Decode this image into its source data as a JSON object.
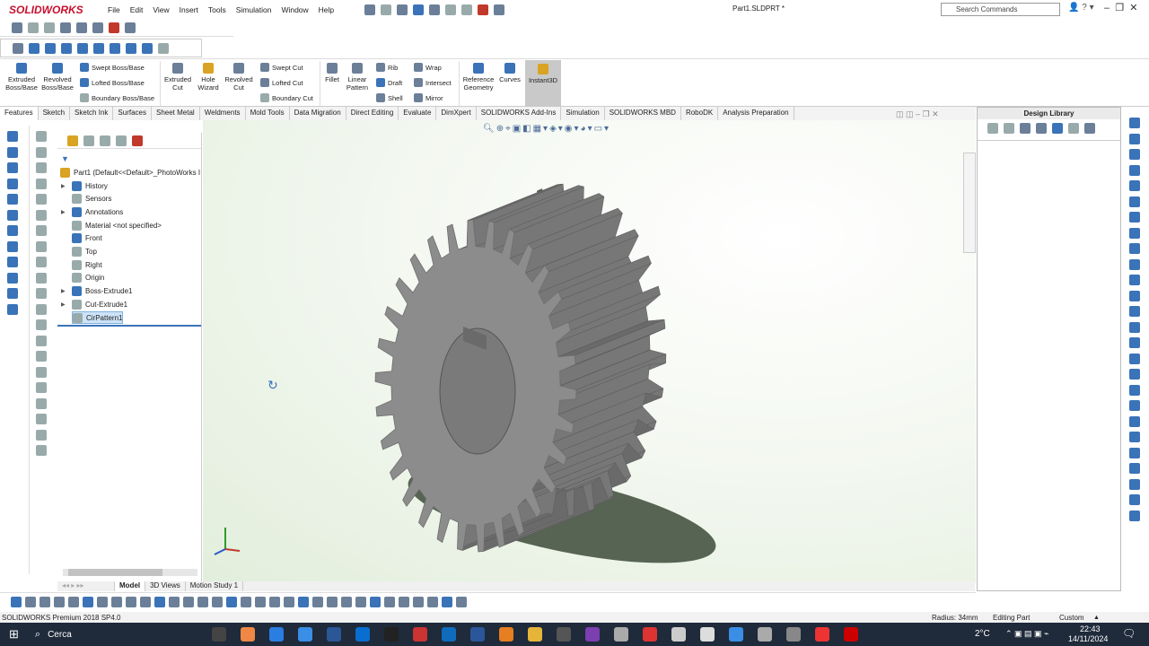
{
  "app": {
    "logo": "SOLIDWORKS",
    "title": "Part1.SLDPRT *",
    "search_placeholder": "Search Commands"
  },
  "menu": [
    "File",
    "Edit",
    "View",
    "Insert",
    "Tools",
    "Simulation",
    "Window",
    "Help"
  ],
  "ribbon": {
    "extruded_boss": "Extruded Boss/Base",
    "revolved_boss": "Revolved Boss/Base",
    "swept_boss": "Swept Boss/Base",
    "lofted_boss": "Lofted Boss/Base",
    "boundary_boss": "Boundary Boss/Base",
    "extruded_cut": "Extruded Cut",
    "hole_wizard": "Hole Wizard",
    "revolved_cut": "Revolved Cut",
    "swept_cut": "Swept Cut",
    "lofted_cut": "Lofted Cut",
    "boundary_cut": "Boundary Cut",
    "fillet": "Fillet",
    "linear_pattern": "Linear Pattern",
    "rib": "Rib",
    "draft": "Draft",
    "shell": "Shell",
    "wrap": "Wrap",
    "intersect": "Intersect",
    "mirror": "Mirror",
    "reference_geometry": "Reference Geometry",
    "curves": "Curves",
    "instant3d": "Instant3D"
  },
  "tabs": [
    "Features",
    "Sketch",
    "Sketch Ink",
    "Surfaces",
    "Sheet Metal",
    "Weldments",
    "Mold Tools",
    "Data Migration",
    "Direct Editing",
    "Evaluate",
    "DimXpert",
    "SOLIDWORKS Add-Ins",
    "Simulation",
    "SOLIDWORKS MBD",
    "RoboDK",
    "Analysis Preparation"
  ],
  "tree": {
    "root": "Part1  (Default<<Default>_PhotoWorks I",
    "items": [
      "History",
      "Sensors",
      "Annotations",
      "Material <not specified>",
      "Front",
      "Top",
      "Right",
      "Origin",
      "Boss-Extrude1",
      "Cut-Extrude1",
      "CirPattern1"
    ]
  },
  "design_library": {
    "title": "Design Library"
  },
  "bottom_tabs": [
    "Model",
    "3D Views",
    "Motion Study 1"
  ],
  "status": {
    "product": "SOLIDWORKS Premium 2018 SP4.0",
    "radius": "Radius: 34mm",
    "mode": "Editing Part",
    "units": "Custom"
  },
  "taskbar": {
    "search": "Cerca",
    "weather": "2°C",
    "time": "22:43",
    "date": "14/11/2024"
  },
  "colors": {
    "gear": "#8c8c8c",
    "shadow": "#3d4a38",
    "accent": "#c8102e"
  }
}
